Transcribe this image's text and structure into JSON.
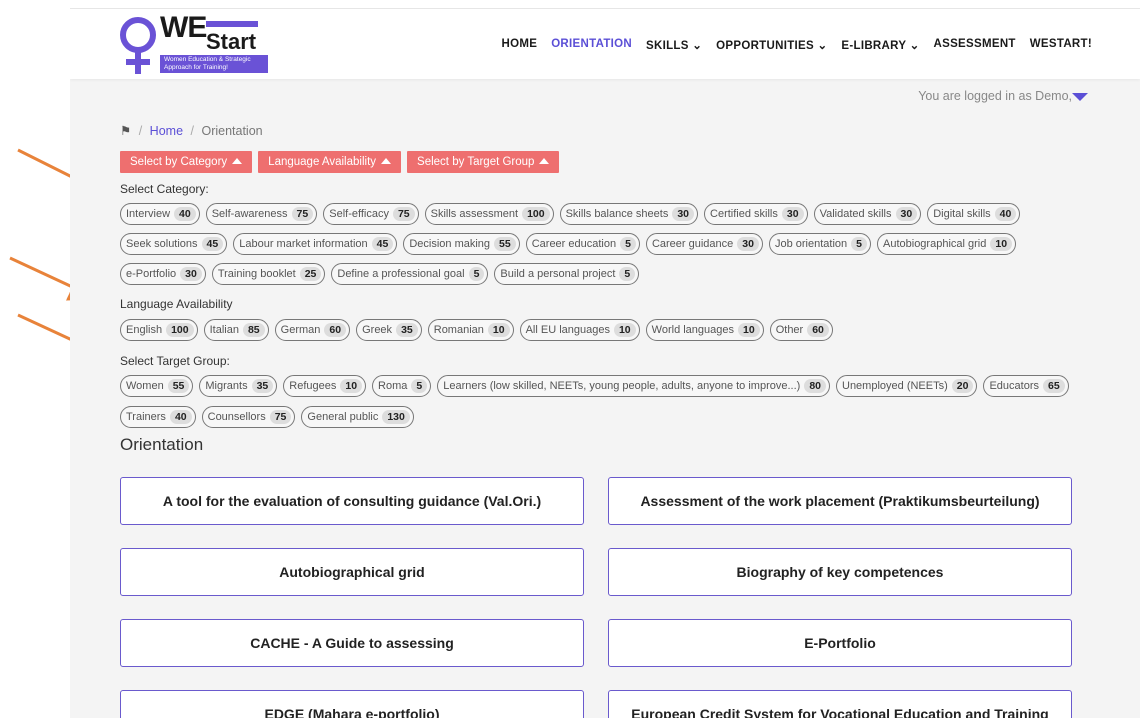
{
  "brand": {
    "name_we": "WE",
    "name_start": "Start",
    "tagline": "Women Education & Strategic Approach for Training!",
    "accent_color": "#6a52d6"
  },
  "nav": {
    "items": [
      {
        "label": "HOME",
        "active": false
      },
      {
        "label": "ORIENTATION",
        "active": true
      },
      {
        "label": "SKILLS ⌄",
        "active": false
      },
      {
        "label": "OPPORTUNITIES ⌄",
        "active": false
      },
      {
        "label": "E-LIBRARY ⌄",
        "active": false
      },
      {
        "label": "ASSESSMENT",
        "active": false
      },
      {
        "label": "WESTART!",
        "active": false
      }
    ]
  },
  "user": {
    "status": "You are logged in as Demo,"
  },
  "breadcrumb": {
    "home": "Home",
    "current": "Orientation",
    "icon": "home-icon"
  },
  "filters": [
    {
      "label": "Select by Category"
    },
    {
      "label": "Language Availability"
    },
    {
      "label": "Select by Target Group"
    }
  ],
  "category": {
    "label": "Select Category:",
    "rows": [
      [
        {
          "name": "Interview",
          "count": "40"
        },
        {
          "name": "Self-awareness",
          "count": "75"
        },
        {
          "name": "Self-efficacy",
          "count": "75"
        },
        {
          "name": "Skills assessment",
          "count": "100"
        },
        {
          "name": "Skills balance sheets",
          "count": "30"
        },
        {
          "name": "Certified skills",
          "count": "30"
        },
        {
          "name": "Validated skills",
          "count": "30"
        },
        {
          "name": "Digital skills",
          "count": "40"
        }
      ],
      [
        {
          "name": "Seek solutions",
          "count": "45"
        },
        {
          "name": "Labour market information",
          "count": "45"
        },
        {
          "name": "Decision making",
          "count": "55"
        },
        {
          "name": "Career education",
          "count": "5"
        },
        {
          "name": "Career guidance",
          "count": "30"
        },
        {
          "name": "Job orientation",
          "count": "5"
        },
        {
          "name": "Autobiographical grid",
          "count": "10"
        }
      ],
      [
        {
          "name": "e-Portfolio",
          "count": "30"
        },
        {
          "name": "Training booklet",
          "count": "25"
        },
        {
          "name": "Define a professional goal",
          "count": "5"
        },
        {
          "name": "Build a personal project",
          "count": "5"
        }
      ]
    ]
  },
  "language": {
    "label": "Language Availability",
    "rows": [
      [
        {
          "name": "English",
          "count": "100"
        },
        {
          "name": "Italian",
          "count": "85"
        },
        {
          "name": "German",
          "count": "60"
        },
        {
          "name": "Greek",
          "count": "35"
        },
        {
          "name": "Romanian",
          "count": "10"
        },
        {
          "name": "All EU languages",
          "count": "10"
        },
        {
          "name": "World languages",
          "count": "10"
        },
        {
          "name": "Other",
          "count": "60"
        }
      ]
    ]
  },
  "target": {
    "label": "Select Target Group:",
    "rows": [
      [
        {
          "name": "Women",
          "count": "55"
        },
        {
          "name": "Migrants",
          "count": "35"
        },
        {
          "name": "Refugees",
          "count": "10"
        },
        {
          "name": "Roma",
          "count": "5"
        },
        {
          "name": "Learners (low skilled, NEETs, young people, adults, anyone to improve...)",
          "count": "80"
        },
        {
          "name": "Unemployed (NEETs)",
          "count": "20"
        },
        {
          "name": "Educators",
          "count": "65"
        }
      ],
      [
        {
          "name": "Trainers",
          "count": "40"
        },
        {
          "name": "Counsellors",
          "count": "75"
        },
        {
          "name": "General public",
          "count": "130"
        }
      ]
    ]
  },
  "orientation": {
    "title": "Orientation",
    "cards": [
      "A tool for the evaluation of consulting guidance (Val.Ori.)",
      "Assessment of the work placement (Praktikumsbeurteilung)",
      "Autobiographical grid",
      "Biography of key competences",
      "CACHE - A Guide to assessing",
      "E-Portfolio",
      "EDGE (Mahara e-portfolio)",
      "European Credit System for Vocational Education and Training"
    ]
  },
  "colors": {
    "filter_button": "#ee6f6f",
    "card_border": "#6a5acd",
    "annotation_arrow": "#e8833a"
  }
}
